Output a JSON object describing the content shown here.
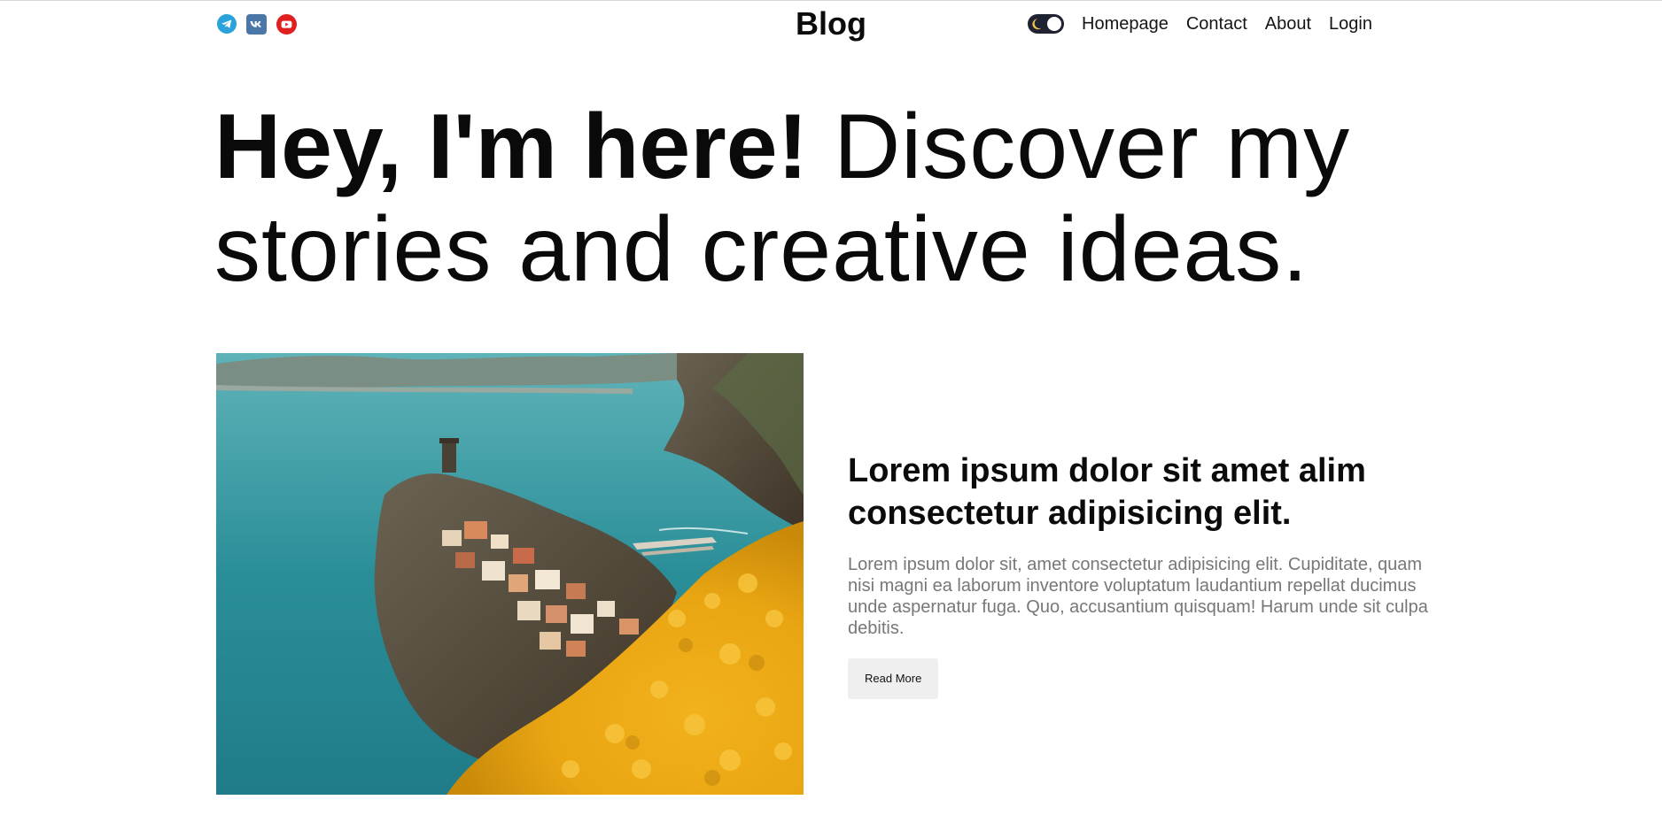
{
  "header": {
    "brand": "Blog",
    "socials": [
      {
        "name": "telegram-icon",
        "color": "#2AA3DB"
      },
      {
        "name": "vk-icon",
        "color": "#4A76A8"
      },
      {
        "name": "youtube-icon",
        "color": "#E01F1F"
      }
    ],
    "theme_toggle": {
      "icon": "moon-icon",
      "state": "dark",
      "background": "#1F2230",
      "moon_color": "#F2C14E"
    },
    "nav": [
      "Homepage",
      "Contact",
      "About",
      "Login"
    ]
  },
  "hero": {
    "bold": "Hey, I'm here!",
    "light": "Discover my stories and creative ideas."
  },
  "featured_post": {
    "image": "coastal-village-photo",
    "title": "Lorem ipsum dolor sit amet alim consectetur adipisicing elit.",
    "excerpt": "Lorem ipsum dolor sit, amet consectetur adipisicing elit. Cupiditate, quam nisi magni ea laborum inventore voluptatum laudantium repellat ducimus unde aspernatur fuga. Quo, accusantium quisquam! Harum unde sit culpa debitis.",
    "button": "Read More"
  }
}
